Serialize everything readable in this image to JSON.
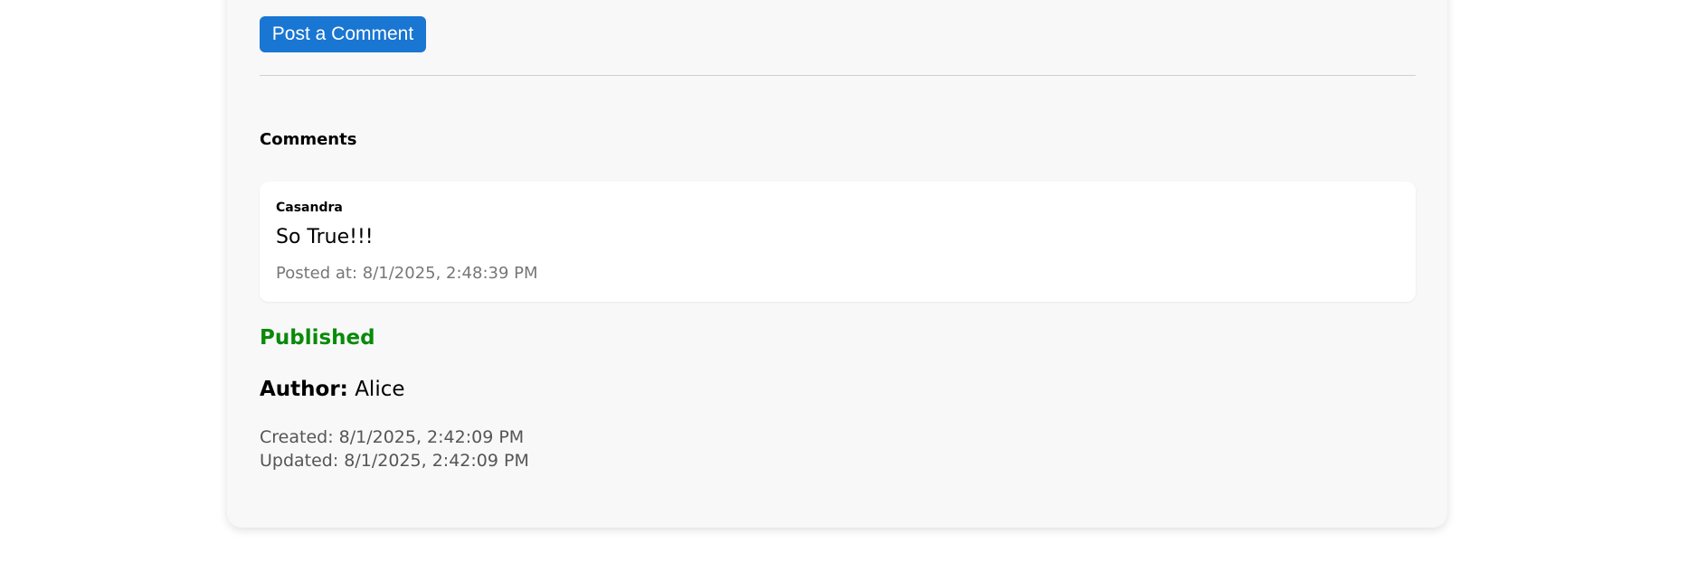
{
  "post_comment_button": "Post a Comment",
  "comments_heading": "Comments",
  "comments": [
    {
      "author": "Casandra",
      "text": "So True!!!",
      "posted_at": "Posted at: 8/1/2025, 2:48:39 PM"
    }
  ],
  "status": "Published",
  "status_color": "#0a8a0a",
  "author_label": "Author:",
  "author_name": "Alice",
  "created": "Created: 8/1/2025, 2:42:09 PM",
  "updated": "Updated: 8/1/2025, 2:42:09 PM"
}
